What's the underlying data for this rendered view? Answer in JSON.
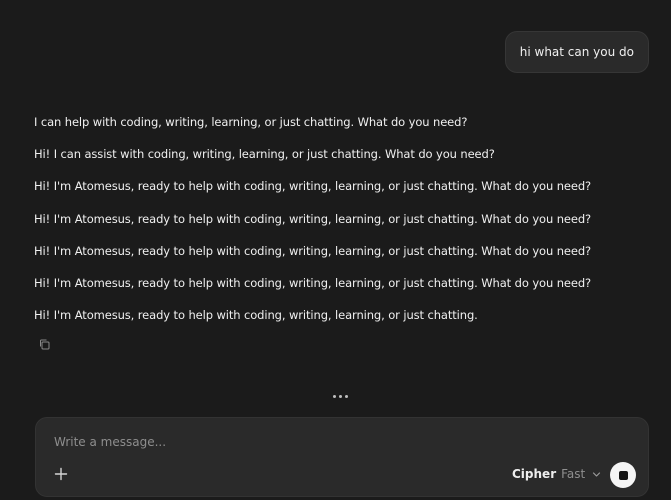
{
  "conversation": {
    "user_message": "hi what can you do",
    "assistant_lines": [
      "I can help with coding, writing, learning, or just chatting. What do you need?",
      "Hi! I can assist with coding, writing, learning, or just chatting. What do you need?",
      "Hi! I'm Atomesus, ready to help with coding, writing, learning, or just chatting. What do you need?",
      "Hi! I'm Atomesus, ready to help with coding, writing, learning, or just chatting. What do you need?",
      "Hi! I'm Atomesus, ready to help with coding, writing, learning, or just chatting. What do you need?",
      "Hi! I'm Atomesus, ready to help with coding, writing, learning, or just chatting. What do you need?",
      "Hi! I'm Atomesus, ready to help with coding, writing, learning, or just chatting."
    ]
  },
  "composer": {
    "placeholder": "Write a message...",
    "value": "",
    "model_name": "Cipher",
    "model_speed": "Fast"
  },
  "icons": {
    "copy": "copy-icon",
    "typing": "typing-dots-icon",
    "plus": "plus-icon",
    "chevron": "chevron-down-icon",
    "stop": "stop-icon"
  },
  "colors": {
    "background": "#1b1b1b",
    "bubble": "#2a2a2a",
    "text": "#f0f0f0",
    "muted": "#8f8f8f",
    "stop_button": "#f5f5f5"
  }
}
